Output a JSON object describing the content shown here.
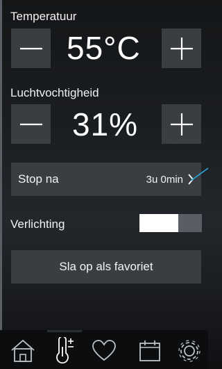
{
  "temperature": {
    "label": "Temperatuur",
    "value": "55°C",
    "decrease_icon": "minus-icon",
    "increase_icon": "plus-icon"
  },
  "humidity": {
    "label": "Luchtvochtigheid",
    "value": "31%",
    "decrease_icon": "minus-icon",
    "increase_icon": "plus-icon"
  },
  "stop_after": {
    "label": "Stop na",
    "value": "3u 0min",
    "icon": "chevron-right-icon"
  },
  "lighting": {
    "label": "Verlichting",
    "toggle_state": "on"
  },
  "favorite_button": {
    "label": "Sla op als favoriet"
  },
  "nav": {
    "items": [
      {
        "icon": "home-icon",
        "active": false
      },
      {
        "icon": "thermometer-plus-icon",
        "active": true
      },
      {
        "icon": "heart-icon",
        "active": false
      },
      {
        "icon": "calendar-icon",
        "active": false
      },
      {
        "icon": "gear-icon",
        "active": false
      }
    ]
  },
  "colors": {
    "accent_line": "#2aa8d8",
    "button_bg": "#3a3d42",
    "background": "#1b1e21"
  }
}
